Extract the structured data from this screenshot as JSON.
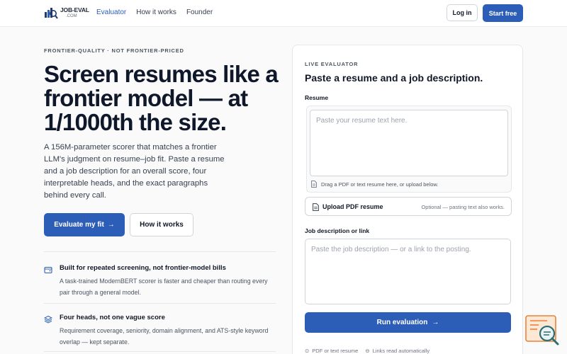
{
  "nav": {
    "logo_name": "JOB-EVAL",
    "logo_sub": ".COM",
    "links": [
      "Evaluator",
      "How it works",
      "Founder"
    ],
    "login": "Log in",
    "start": "Start free"
  },
  "hero": {
    "eyebrow": "FRONTIER-QUALITY · NOT FRONTIER-PRICED",
    "headline": "Screen resumes like a frontier model — at 1/1000th the size.",
    "lede": "A 156M-parameter scorer that matches a frontier LLM's judgment on resume–job fit. Paste a resume and a job description for an overall score, four interpretable heads, and the exact paragraphs behind every call.",
    "cta_primary": "Evaluate my fit",
    "cta_secondary": "How it works"
  },
  "features": [
    {
      "icon": "wallet-icon",
      "title": "Built for repeated screening, not frontier-model bills",
      "body": "A task-trained ModernBERT scorer is faster and cheaper than routing every pair through a general model."
    },
    {
      "icon": "layers-icon",
      "title": "Four heads, not one vague score",
      "body": "Requirement coverage, seniority, domain alignment, and ATS-style keyword overlap — kept separate."
    }
  ],
  "evaluator": {
    "eyebrow": "LIVE EVALUATOR",
    "title": "Paste a resume and a job description.",
    "resume_label": "Resume",
    "resume_placeholder": "Paste your resume text here.",
    "resume_value": "",
    "drop_hint": "Drag a PDF or text resume here, or upload below.",
    "upload_label": "Upload PDF resume",
    "upload_note": "Optional — pasting text also works.",
    "jd_label": "Job description or link",
    "jd_placeholder": "Paste the job description — or a link to the posting.",
    "jd_value": "",
    "run_label": "Run evaluation",
    "meta": [
      "PDF or text resume",
      "Links read automatically"
    ]
  },
  "colors": {
    "accent": "#2c5eb8",
    "widget_orange": "#e8823a",
    "widget_teal": "#2f6f73"
  }
}
